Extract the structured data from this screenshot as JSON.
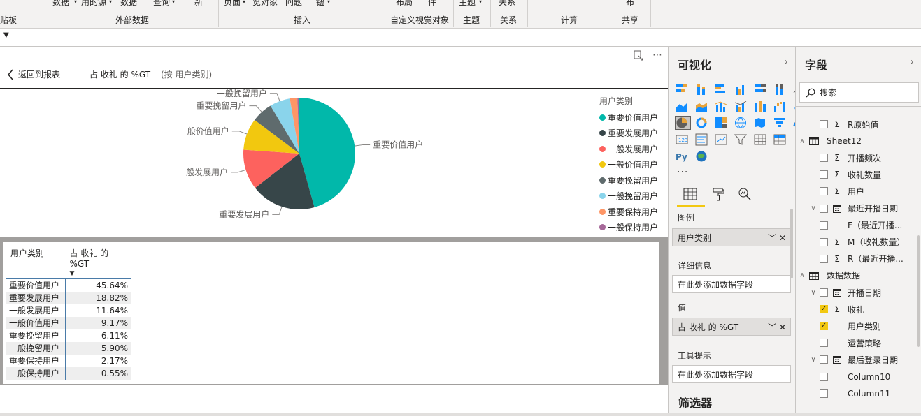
{
  "ribbon": {
    "items": [
      "数据",
      "用的源",
      "数据",
      "查询",
      "新",
      "页面",
      "览对象",
      "问题",
      "钮",
      "布局",
      "件",
      "主题",
      "关系",
      "布"
    ],
    "groups": [
      "贴板",
      "外部数据",
      "插入",
      "自定义视觉对象",
      "主题",
      "关系",
      "计算",
      "共享"
    ]
  },
  "drill": {
    "back_label": "返回到报表",
    "title": "占 收礼 的 %GT",
    "subtitle": "(按 用户类别)"
  },
  "chart_data": {
    "type": "pie",
    "legend_title": "用户类别",
    "legend_position": "right",
    "categories": [
      "重要价值用户",
      "重要发展用户",
      "一般发展用户",
      "一般价值用户",
      "重要挽留用户",
      "一般挽留用户",
      "重要保持用户",
      "一般保持用户"
    ],
    "values": [
      45.64,
      18.82,
      11.64,
      9.17,
      6.11,
      5.9,
      2.17,
      0.55
    ],
    "colors": [
      "#01b8aa",
      "#374649",
      "#fd625e",
      "#f2c80f",
      "#5f6b6d",
      "#8ad4eb",
      "#fe9666",
      "#a66999"
    ],
    "slice_labels": [
      "重要价值用户",
      "重要发展用户",
      "一般发展用户",
      "一般价值用户",
      "重要挽留用户",
      "一般挽留用户"
    ]
  },
  "table": {
    "headers": [
      "用户类别",
      "占 收礼 的 %GT"
    ],
    "rows": [
      [
        "重要价值用户",
        "45.64%"
      ],
      [
        "重要发展用户",
        "18.82%"
      ],
      [
        "一般发展用户",
        "11.64%"
      ],
      [
        "一般价值用户",
        "9.17%"
      ],
      [
        "重要挽留用户",
        "6.11%"
      ],
      [
        "一般挽留用户",
        "5.90%"
      ],
      [
        "重要保持用户",
        "2.17%"
      ],
      [
        "一般保持用户",
        "0.55%"
      ]
    ]
  },
  "viz_pane": {
    "title": "可视化",
    "legend_label": "图例",
    "legend_value": "用户类别",
    "details_label": "详细信息",
    "details_placeholder": "在此处添加数据字段",
    "values_label": "值",
    "values_value": "占 收礼 的 %GT",
    "tooltip_label": "工具提示",
    "tooltip_placeholder": "在此处添加数据字段",
    "filters_title": "筛选器",
    "r_icon": "R",
    "py_icon": "Py",
    "more": "..."
  },
  "fields_pane": {
    "title": "字段",
    "search_placeholder": "搜索",
    "rows": [
      {
        "label": "R原始值",
        "type": "sigma",
        "checked": false,
        "expander": ""
      },
      {
        "label": "Sheet12",
        "type": "table",
        "checked": false,
        "expander": "up"
      },
      {
        "label": "开播频次",
        "type": "sigma",
        "checked": false,
        "expander": ""
      },
      {
        "label": "收礼数量",
        "type": "sigma",
        "checked": false,
        "expander": ""
      },
      {
        "label": "用户",
        "type": "sigma",
        "checked": false,
        "expander": ""
      },
      {
        "label": "最近开播日期",
        "type": "calendar",
        "checked": false,
        "expander": "down"
      },
      {
        "label": "F（最近开播...",
        "type": "none",
        "checked": false,
        "expander": ""
      },
      {
        "label": "M（收礼数量）",
        "type": "sigma",
        "checked": false,
        "expander": ""
      },
      {
        "label": "R（最近开播...",
        "type": "sigma",
        "checked": false,
        "expander": ""
      },
      {
        "label": "数据数据",
        "type": "table",
        "checked": false,
        "expander": "up"
      },
      {
        "label": "开播日期",
        "type": "calendar",
        "checked": false,
        "expander": "down"
      },
      {
        "label": "收礼",
        "type": "sigma",
        "checked": true,
        "expander": ""
      },
      {
        "label": "用户类别",
        "type": "none",
        "checked": true,
        "expander": ""
      },
      {
        "label": "运营策略",
        "type": "none",
        "checked": false,
        "expander": ""
      },
      {
        "label": "最后登录日期",
        "type": "calendar",
        "checked": false,
        "expander": "down"
      },
      {
        "label": "Column10",
        "type": "none",
        "checked": false,
        "expander": ""
      },
      {
        "label": "Column11",
        "type": "none",
        "checked": false,
        "expander": ""
      }
    ]
  }
}
